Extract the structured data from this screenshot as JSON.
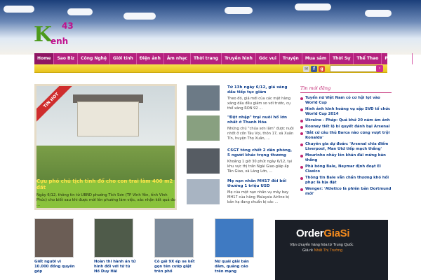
{
  "brand": {
    "logo_main": "K",
    "logo_num": "43",
    "logo_sub": "enh"
  },
  "nav": [
    "Home",
    "Sao Biz",
    "Công Nghệ",
    "Giới tính",
    "Điện ảnh",
    "Âm nhạc",
    "Thời trang",
    "Truyền hình",
    "Góc vui",
    "Truyện",
    "Mua sắm",
    "Thời Sự",
    "Thể Thao",
    "Pháp Luật"
  ],
  "colors": {
    "nav": "#b5217e",
    "accent": "#c02470",
    "link": "#0f3f8c",
    "hot_caption": "#8ac23c"
  },
  "icons": [
    "mail-icon",
    "facebook-icon",
    "google-plus-icon",
    "search-icon"
  ],
  "hot": {
    "ribbon": "TIN HOT",
    "title": "Cựu phó chủ tịch tỉnh đổ cho con trai làm 400 m2 đất",
    "summary": "Ngày 6/12, thông tin từ UBND phường Tích Sơn (TP Vĩnh Yên, tỉnh Vĩnh Phúc) cho biết sau khi được mời lên phường làm việc, xác nhận kết quả đo ..."
  },
  "news": [
    {
      "title": "Từ 13h ngày 6/12, giá xăng dầu tiếp tục giảm",
      "summary": "Theo đó, giá mới của các mặt hàng xăng dầu đều giảm so với trước, cụ thể xăng RON 92 ..."
    },
    {
      "title": "\"Đột nhập\" trại nuôi hổ lớn nhất ở Thanh Hóa",
      "summary": "Những chú \"chúa sơn lâm\" được nuôi nhốt ở cồn Tàu Vọi, thôn 17, xã Xuân Tín, huyện Thọ Xuân, ..."
    },
    {
      "title": "CSGT tông chết 2 dân phòng, 5 người khác trọng thương",
      "summary": "Khoảng 1 giờ 30 phút ngày 6/12, tại khu vực thị trấn Ngải Giao-giáp ấp Tân Giao, xã Láng Lớn, ..."
    },
    {
      "title": "Mẹ nạn nhân MH17 đòi bồi thường 1 triệu USD",
      "summary": "Mẹ của một nạn nhân vụ máy bay MH17 của hãng Malaysia Airline bị bắn hạ đang chuẩn bị các ..."
    }
  ],
  "sidebar": {
    "title": "Tin mới đăng",
    "items": [
      "Tuyển nữ Việt Nam có cơ hội lọt vào World Cup",
      "Hình ảnh kinh hoàng vụ sập SVĐ tổ chức World Cup 2014",
      "Ukraine - Pháp: Quả khứ 20 năm ám ảnh",
      "Rooney tiết lộ bí quyết đánh bại Arsenal",
      "'Bắt cứ câu thủ Barca nào cũng vượt trội Ronaldo'",
      "Chuyên gia dự đoán: 'Arsenal chia điểm Liverpool, Man Utd tiếp mạch thắng'",
      "Mourinho nhảy lên khán đài mừng bàn thắng",
      "Phủ bóng Bale, Neymar định đoạt El Clasico",
      "Thông tin Bale vẫn chấn thương khó hồi phục là bịa đặt",
      "Wenger: 'Atletico là phiên bản Dortmund mới'"
    ]
  },
  "bottom": [
    "Giết người vì 10.000 đồng quyên góp",
    "Hoàn thi hành án tử hình đối với tử tù Hồ Duy Hải",
    "Cô gái 9X ép se kết gọn tên cướp giật trên phố",
    "Nữ quái giải bán dâm, quảng cáo trên mạng"
  ],
  "ad": {
    "line1a": "Order",
    "line1b": "GiaSi",
    "line2": "Vận chuyển hàng hóa từ Trung Quốc",
    "line3a": "Giá rẻ ",
    "line3b": "Nhất Thị Trường"
  }
}
